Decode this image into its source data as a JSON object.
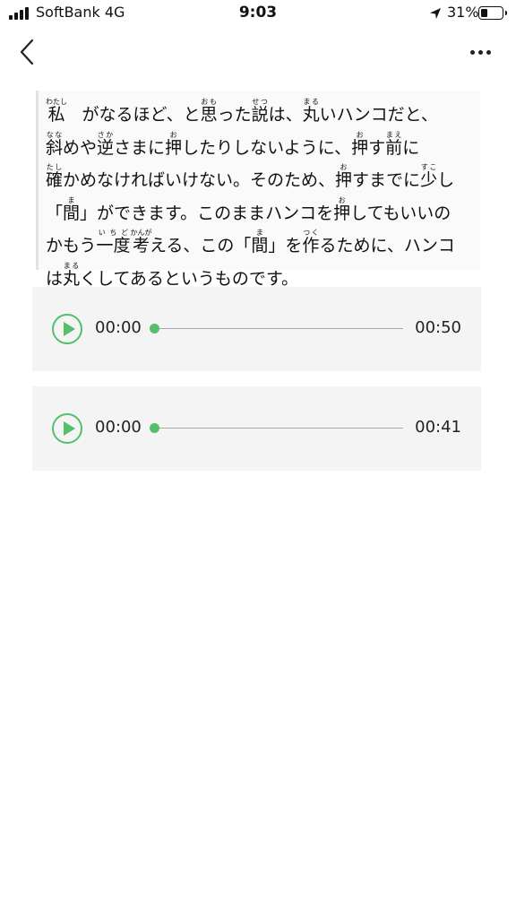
{
  "status_bar": {
    "carrier": "SoftBank   4G",
    "time": "9:03",
    "battery_percent": "31%",
    "battery_level": 0.31,
    "icons": [
      "signal-icon",
      "location-arrow-icon",
      "battery-icon"
    ]
  },
  "nav": {
    "back_icon": "chevron-left-icon",
    "more_icon": "ellipsis-icon"
  },
  "document": {
    "l1_a": "私",
    "l1_a_rt": "わたし",
    "l1_b": "がなるほど、と",
    "l1_c": "思",
    "l1_c_rt": "おも",
    "l1_d": "った",
    "l1_e": "説",
    "l1_e_rt": "せつ",
    "l1_f": "は、",
    "l1_g": "丸",
    "l1_g_rt": "まる",
    "l1_h": "いハンコだと、",
    "l2_a": "斜",
    "l2_a_rt": "なな",
    "l2_b": "めや",
    "l2_c": "逆",
    "l2_c_rt": "さか",
    "l2_d": "さまに",
    "l2_e": "押",
    "l2_e_rt": "お",
    "l2_f": "したりしないように、",
    "l2_g": "押",
    "l2_g_rt": "お",
    "l2_h": "す",
    "l2_i": "前",
    "l2_i_rt": "まえ",
    "l2_j": "に",
    "l3_a": "確",
    "l3_a_rt": "たし",
    "l3_b": "かめなければいけない。そのため、",
    "l3_c": "押",
    "l3_c_rt": "お",
    "l3_d": "すまでに",
    "l3_e": "少",
    "l3_e_rt": "すこ",
    "l3_f": "し",
    "l4_a": "「",
    "l4_b": "間",
    "l4_b_rt": "ま",
    "l4_c": "」ができます。このままハンコを",
    "l4_d": "押",
    "l4_d_rt": "お",
    "l4_e": "してもいいの",
    "l5_a": "かもう",
    "l5_b": "一度",
    "l5_b_rt": "いちど",
    "l5_c": "考",
    "l5_c_rt": "かんが",
    "l5_d": "える、この「",
    "l5_e": "間",
    "l5_e_rt": "ま",
    "l5_f": "」を",
    "l5_g": "作",
    "l5_g_rt": "つく",
    "l5_h": "るために、ハンコ",
    "l6_a": "は",
    "l6_b": "丸",
    "l6_b_rt": "まる",
    "l6_c": "くしてあるというものです。"
  },
  "audio_players": [
    {
      "current_time": "00:00",
      "duration": "00:50",
      "progress": 0
    },
    {
      "current_time": "00:00",
      "duration": "00:41",
      "progress": 0
    }
  ],
  "colors": {
    "accent": "#53bf6b",
    "card_bg": "#f4f4f4",
    "track": "#a8a8a8"
  }
}
